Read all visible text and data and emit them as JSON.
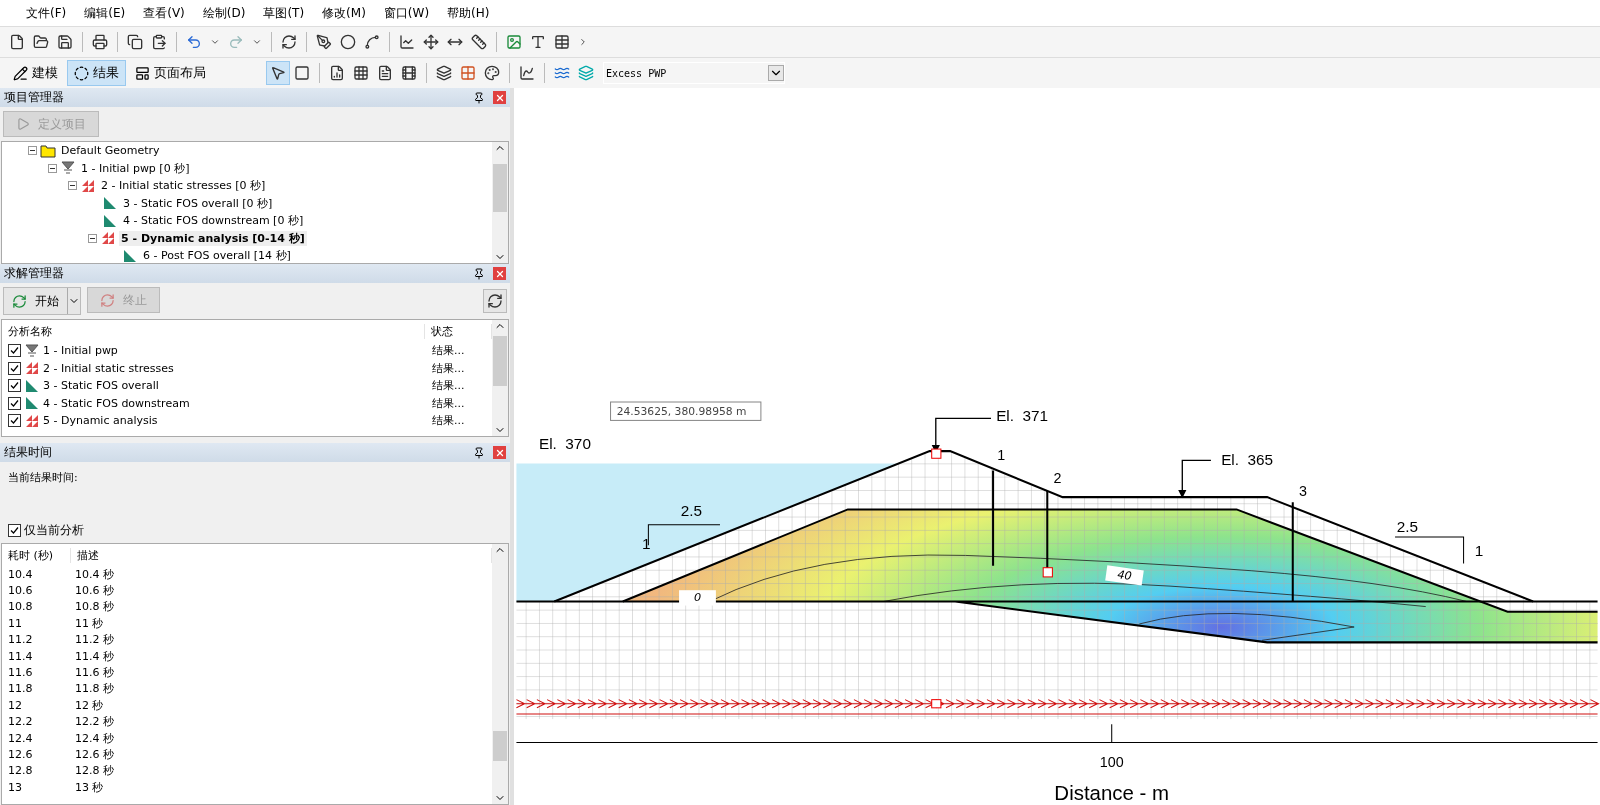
{
  "menu": [
    {
      "label": "文件(F)"
    },
    {
      "label": "编辑(E)"
    },
    {
      "label": "查看(V)"
    },
    {
      "label": "绘制(D)"
    },
    {
      "label": "草图(T)"
    },
    {
      "label": "修改(M)"
    },
    {
      "label": "窗口(W)"
    },
    {
      "label": "帮助(H)"
    }
  ],
  "mode_tabs": [
    {
      "label": "建模",
      "kind": "model",
      "selected": false
    },
    {
      "label": "结果",
      "kind": "results",
      "selected": true
    },
    {
      "label": "页面布局",
      "kind": "layout",
      "selected": false
    }
  ],
  "result_select": {
    "value": "Excess PWP"
  },
  "project_manager": {
    "title": "项目管理器",
    "define_button": {
      "label": "定义项目",
      "disabled": true
    },
    "tree": [
      {
        "label": "Default Geometry",
        "kind": "geometry",
        "expanded": true,
        "selected": false,
        "children": [
          {
            "label": "1 - Initial pwp [0 秒]",
            "kind": "pwp",
            "expanded": true,
            "selected": false,
            "children": [
              {
                "label": "2 - Initial static stresses [0 秒]",
                "kind": "stress",
                "expanded": true,
                "selected": false,
                "children": [
                  {
                    "label": "3 - Static FOS overall [0 秒]",
                    "kind": "slope",
                    "selected": false
                  },
                  {
                    "label": "4 - Static FOS downstream  [0 秒]",
                    "kind": "slope",
                    "selected": false
                  },
                  {
                    "label": "5 - Dynamic analysis [0-14 秒]",
                    "kind": "stress",
                    "expanded": true,
                    "selected": true,
                    "children": [
                      {
                        "label": "6 - Post FOS overall [14 秒]",
                        "kind": "slope",
                        "selected": false
                      }
                    ]
                  }
                ]
              }
            ]
          }
        ]
      }
    ]
  },
  "solve_manager": {
    "title": "求解管理器",
    "start_button": {
      "label": "开始"
    },
    "stop_button": {
      "label": "终止",
      "disabled": true
    },
    "columns": [
      "分析名称",
      "状态"
    ],
    "rows": [
      {
        "name": "1 - Initial pwp",
        "kind": "pwp",
        "checked": true,
        "status": "结果..."
      },
      {
        "name": "2 - Initial static stresses",
        "kind": "stress",
        "checked": true,
        "status": "结果..."
      },
      {
        "name": "3 - Static FOS overall",
        "kind": "slope",
        "checked": true,
        "status": "结果..."
      },
      {
        "name": "4 - Static FOS downstream",
        "kind": "slope",
        "checked": true,
        "status": "结果..."
      },
      {
        "name": "5 - Dynamic analysis",
        "kind": "stress",
        "checked": true,
        "status": "结果..."
      }
    ]
  },
  "result_time": {
    "title": "结果时间",
    "current_label": "当前结果时间:",
    "only_current": {
      "label": "仅当前分析",
      "checked": true
    },
    "columns": [
      "耗时 (秒)",
      "描述"
    ],
    "rows": [
      {
        "time": "10.4",
        "description": "10.4 秒"
      },
      {
        "time": "10.6",
        "description": "10.6 秒"
      },
      {
        "time": "10.8",
        "description": "10.8 秒"
      },
      {
        "time": "11",
        "description": "11 秒"
      },
      {
        "time": "11.2",
        "description": "11.2 秒"
      },
      {
        "time": "11.4",
        "description": "11.4 秒"
      },
      {
        "time": "11.6",
        "description": "11.6 秒"
      },
      {
        "time": "11.8",
        "description": "11.8 秒"
      },
      {
        "time": "12",
        "description": "12 秒"
      },
      {
        "time": "12.2",
        "description": "12.2 秒"
      },
      {
        "time": "12.4",
        "description": "12.4 秒"
      },
      {
        "time": "12.6",
        "description": "12.6 秒"
      },
      {
        "time": "12.8",
        "description": "12.8 秒"
      },
      {
        "time": "13",
        "description": "13 秒"
      }
    ]
  },
  "canvas": {
    "tooltip": "24.53625, 380.98958 m",
    "labels": [
      {
        "text": "El.  370",
        "kind": "elevation"
      },
      {
        "text": "El.  371",
        "kind": "elevation"
      },
      {
        "text": "El.  365",
        "kind": "elevation"
      },
      {
        "text": "1",
        "kind": "section"
      },
      {
        "text": "2",
        "kind": "section"
      },
      {
        "text": "3",
        "kind": "section"
      },
      {
        "text": "2.5",
        "kind": "slope"
      },
      {
        "text": "1",
        "kind": "slope"
      },
      {
        "text": "2.5",
        "kind": "slope"
      },
      {
        "text": "1",
        "kind": "slope"
      },
      {
        "text": "0",
        "kind": "contour"
      },
      {
        "text": "40",
        "kind": "contour"
      },
      {
        "text": "100",
        "kind": "tick"
      },
      {
        "text": "Distance - m",
        "kind": "axis_title"
      }
    ]
  }
}
